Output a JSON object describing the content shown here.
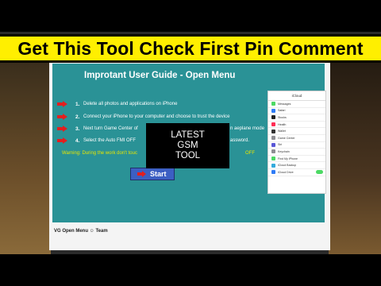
{
  "banner": {
    "text": "Get This Tool Check First Pin Comment"
  },
  "guide": {
    "title": "Improtant User Guide - Open Menu",
    "steps": [
      {
        "num": "1.",
        "text": "Delete all photos and applications on iPhone"
      },
      {
        "num": "2.",
        "text": "Connect your iPhone to your computer and choose to trust the device"
      },
      {
        "num": "3.",
        "text": "Next turn Game Center of",
        "text_tail": "n aeplane mode"
      },
      {
        "num": "4.",
        "text": "Select the Auto FMI OFF",
        "text_tail": "assword."
      }
    ],
    "warning": "Warning: During the work don't touc",
    "warning_tail": "OFF",
    "start_label": "Start",
    "footer": "VG Open Menu ☺ Team"
  },
  "overlay": {
    "line1": "LATEST",
    "line2": "GSM",
    "line3": "TOOL"
  },
  "phone": {
    "header": "iCloud",
    "rows": [
      {
        "label": "Messages",
        "color": "#4cd964"
      },
      {
        "label": "Safari",
        "color": "#2f7cf6"
      },
      {
        "label": "Stocks",
        "color": "#222222"
      },
      {
        "label": "Health",
        "color": "#ff2d55"
      },
      {
        "label": "Wallet",
        "color": "#333333"
      },
      {
        "label": "Game Center",
        "color": "#8e8e93"
      },
      {
        "label": "Siri",
        "color": "#5856d6"
      },
      {
        "label": "Keychain",
        "color": "#8e8e93"
      },
      {
        "label": "Find My iPhone",
        "color": "#4cd964"
      },
      {
        "label": "iCloud Backup",
        "color": "#34aadc"
      },
      {
        "label": "iCloud Drive",
        "color": "#2f7cf6"
      }
    ]
  },
  "colors": {
    "banner": "#ffef00",
    "screen": "#2a9296",
    "arrow": "#e21f1f",
    "warning": "#e8e500",
    "start_button": "#3c5fc3"
  }
}
